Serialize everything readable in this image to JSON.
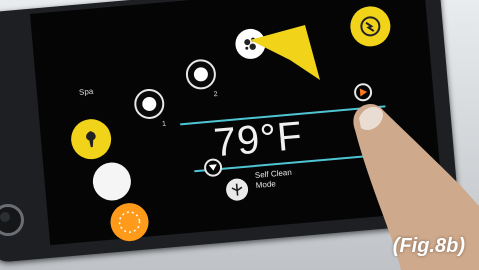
{
  "spa_panel": {
    "mode_label": "Spa",
    "pump_1_number": "1",
    "pump_2_number": "2",
    "temperature": "79°F",
    "self_clean_line1": "Self Clean",
    "self_clean_line2": "Mode"
  },
  "figure_label": "(Fig.8b)",
  "colors": {
    "accent_cyan": "#4fc5d3",
    "yellow": "#f1d31a",
    "orange": "#ff9a1a",
    "arrow_orange": "#ff7a1a"
  },
  "icons": {
    "tree": "tree-icon",
    "bubbles": "bubbles-icon",
    "sun": "sun-icon",
    "up_arrow": "up-arrow-icon",
    "down_arrow": "down-arrow-icon",
    "clean": "self-clean-icon"
  }
}
